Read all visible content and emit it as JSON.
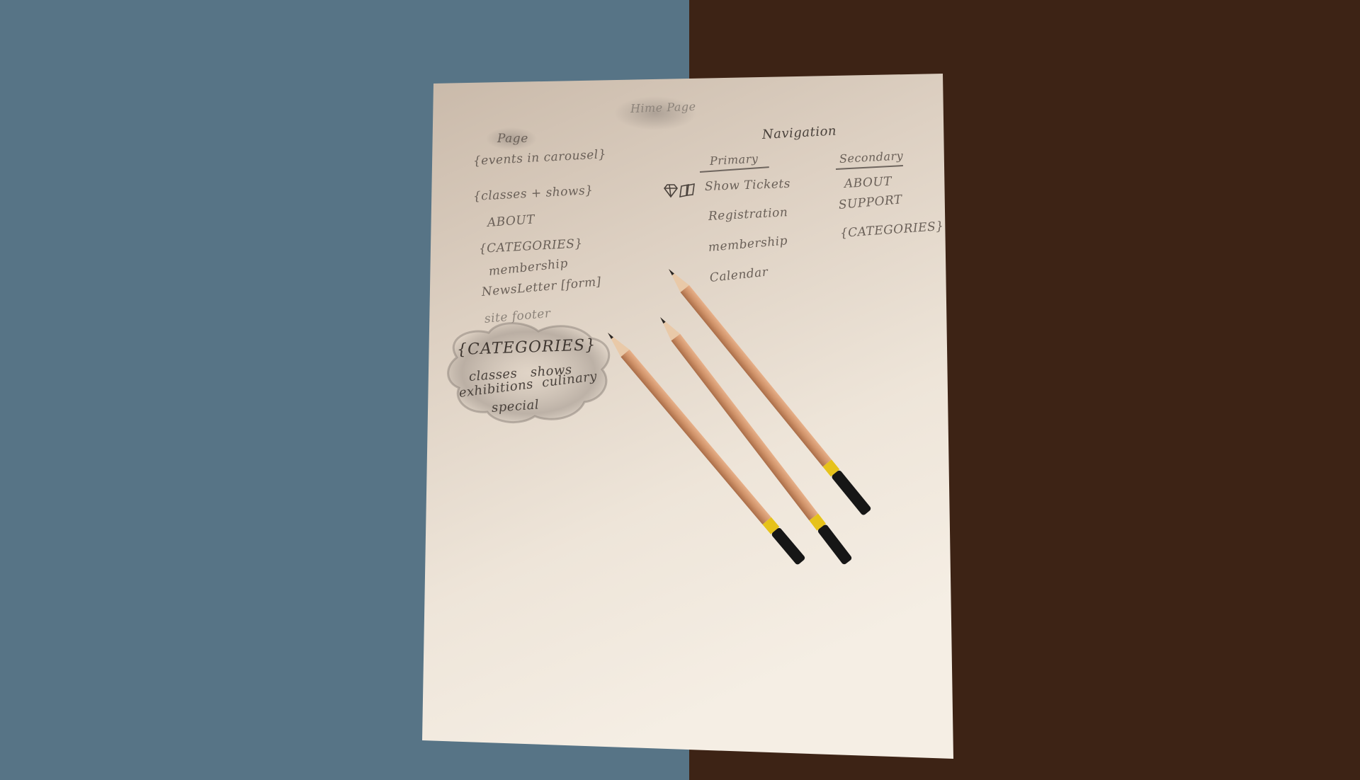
{
  "photo": {
    "colors": {
      "left_backdrop": "#577486",
      "right_backdrop": "#3d2315",
      "paper_light": "#f1e7da",
      "paper_shadow": "#c3b4a6",
      "graphite": "#5a524b",
      "pencil_wood": "#d49a72",
      "pencil_band": "#e6c21a",
      "pencil_end": "#161616"
    }
  },
  "sketch": {
    "title": "Hime Page",
    "page_heading": "Page",
    "page_items": [
      "{events in carousel}",
      "{classes + shows}",
      "ABOUT",
      "{CATEGORIES}",
      "membership",
      "NewsLetter [form]",
      "site footer"
    ],
    "categories_cloud": {
      "title": "{CATEGORIES}",
      "line1": "classes   shows",
      "line2": "exhibitions  culinary",
      "line3": "special"
    },
    "navigation_heading": "Navigation",
    "primary": {
      "heading": "Primary",
      "icons": [
        "diamond-icon",
        "ticket-icon"
      ],
      "items": [
        "Show Tickets",
        "Registration",
        "membership",
        "Calendar"
      ]
    },
    "secondary": {
      "heading": "Secondary",
      "items": [
        "ABOUT",
        "SUPPORT",
        "{CATEGORIES}"
      ]
    }
  }
}
